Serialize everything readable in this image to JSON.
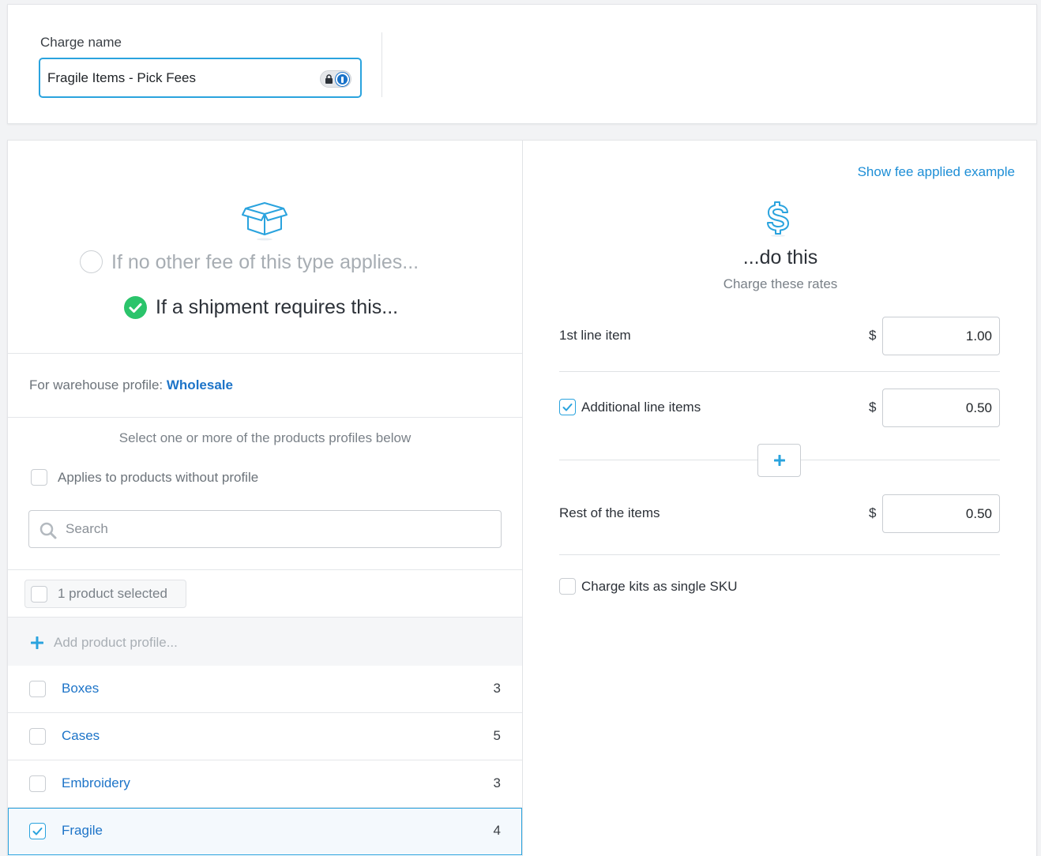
{
  "charge": {
    "label": "Charge name",
    "value": "Fragile Items - Pick Fees"
  },
  "conditions": {
    "option_no_other": "If no other fee of this type applies...",
    "option_requires": "If a shipment requires this...",
    "selected_option": "option_requires"
  },
  "warehouse": {
    "prefix": "For warehouse profile: ",
    "profile": "Wholesale"
  },
  "products": {
    "hint": "Select one or more of the products profiles below",
    "without_profile_label": "Applies to products without profile",
    "without_profile_checked": false,
    "search_placeholder": "Search",
    "selected_count_label": "1 product selected",
    "add_profile_label": "Add product profile...",
    "rows": [
      {
        "name": "Boxes",
        "count": "3",
        "checked": false
      },
      {
        "name": "Cases",
        "count": "5",
        "checked": false
      },
      {
        "name": "Embroidery",
        "count": "3",
        "checked": false
      },
      {
        "name": "Fragile",
        "count": "4",
        "checked": true
      }
    ]
  },
  "action": {
    "show_example": "Show fee applied example",
    "title": "...do this",
    "subtitle": "Charge these rates",
    "currency": "$",
    "first_line_label": "1st line item",
    "first_line_value": "1.00",
    "additional_label": "Additional line items",
    "additional_checked": true,
    "additional_value": "0.50",
    "rest_label": "Rest of the items",
    "rest_value": "0.50",
    "kits_label": "Charge kits as single SKU",
    "kits_checked": false
  },
  "colors": {
    "accent": "#2aa3de",
    "link": "#1d74c8",
    "success": "#2bc46b"
  }
}
